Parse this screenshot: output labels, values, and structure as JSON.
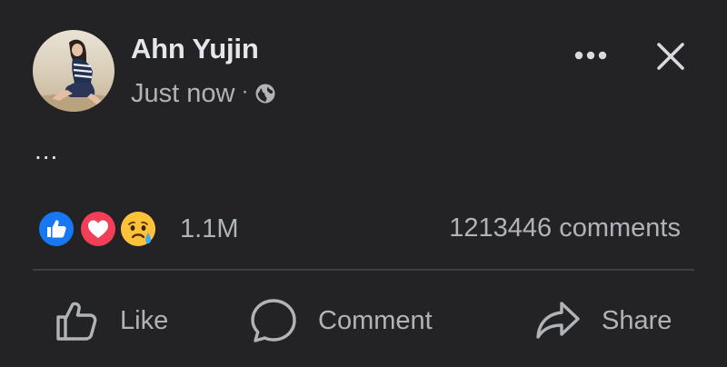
{
  "post": {
    "author": "Ahn Yujin",
    "timestamp": "Just now",
    "separator": "·",
    "privacy_icon": "globe-icon",
    "text": "...",
    "more_icon": "more-dots-icon",
    "close_icon": "close-icon"
  },
  "reactions": {
    "icons": [
      "like-reaction-icon",
      "love-reaction-icon",
      "care-sad-reaction-icon"
    ],
    "count": "1.1M"
  },
  "comments": {
    "label": "1213446 comments"
  },
  "actions": {
    "like": {
      "label": "Like",
      "icon": "thumbs-up-icon"
    },
    "comment": {
      "label": "Comment",
      "icon": "comment-bubble-icon"
    },
    "share": {
      "label": "Share",
      "icon": "share-arrow-icon"
    }
  },
  "colors": {
    "background": "#232325",
    "primary_text": "#e4e6eb",
    "secondary_text": "#b0b3b8",
    "divider": "#3e4042",
    "like_blue": "#1877f2",
    "love_red": "#f33e58",
    "emoji_yellow": "#f7b125"
  }
}
